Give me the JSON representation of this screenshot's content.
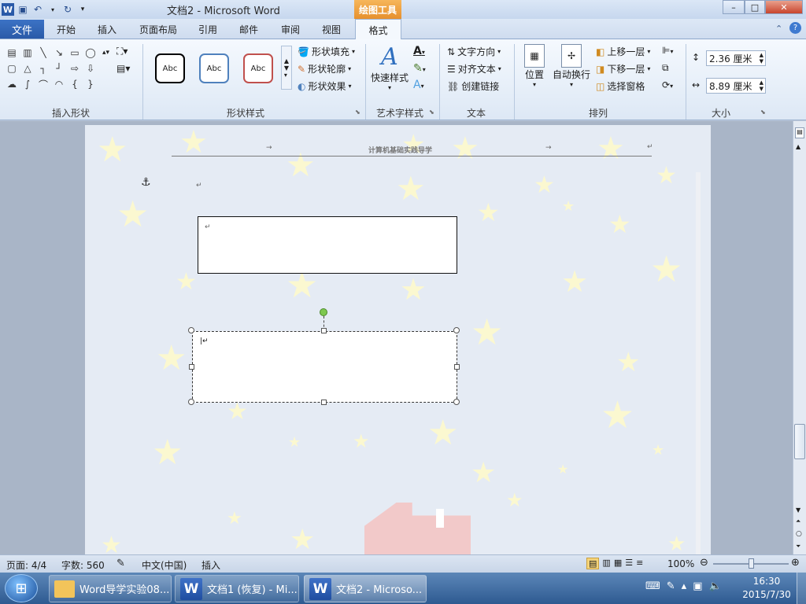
{
  "window": {
    "title": "文档2 - Microsoft Word",
    "context_tools": "绘图工具",
    "minimize": "–",
    "maximize": "□",
    "close": "✕"
  },
  "tabs": {
    "file": "文件",
    "items": [
      "开始",
      "插入",
      "页面布局",
      "引用",
      "邮件",
      "审阅",
      "视图"
    ],
    "format": "格式"
  },
  "ribbon": {
    "groups": {
      "insert_shapes": "插入形状",
      "shape_styles": "形状样式",
      "wordart_styles": "艺术字样式",
      "text": "文本",
      "arrange": "排列",
      "size": "大小"
    },
    "style_samples": [
      "Abc",
      "Abc",
      "Abc"
    ],
    "shape_fill": "形状填充",
    "shape_outline": "形状轮廓",
    "shape_effects": "形状效果",
    "quick_styles": "快速样式",
    "text_direction": "文字方向",
    "align_text": "对齐文本",
    "create_link": "创建链接",
    "position": "位置",
    "wrap_text": "自动换行",
    "bring_forward": "上移一层",
    "send_backward": "下移一层",
    "selection_pane": "选择窗格",
    "height": "2.36 厘米",
    "width": "8.89 厘米"
  },
  "document": {
    "header_text": "计算机基础实践导学",
    "para_mark": "↵",
    "tab_mark": "→",
    "anchor": "⚓"
  },
  "statusbar": {
    "page": "页面: 4/4",
    "words": "字数: 560",
    "language": "中文(中国)",
    "mode": "插入",
    "zoom": "100%"
  },
  "taskbar": {
    "items": [
      "Word导学实验08...",
      "文档1 (恢复) - Mi...",
      "文档2 - Microso..."
    ],
    "time": "16:30",
    "date": "2015/7/30"
  }
}
